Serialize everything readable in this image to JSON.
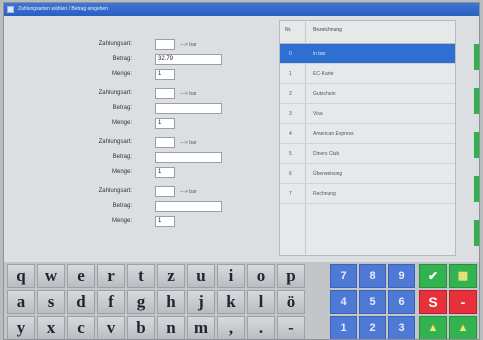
{
  "window": {
    "title": "Zahlungsarten wählen / Betrag eingeben"
  },
  "payments": [
    {
      "zahlungsart_label": "Zahlungsart:",
      "zahlungsart_value": "",
      "selected": "---> bar",
      "betrag_label": "Betrag:",
      "betrag_value": "32.79",
      "menge_label": "Menge:",
      "menge_value": "1"
    },
    {
      "zahlungsart_label": "Zahlungsart:",
      "zahlungsart_value": "",
      "selected": "---> bar",
      "betrag_label": "Betrag:",
      "betrag_value": "",
      "menge_label": "Menge:",
      "menge_value": "1"
    },
    {
      "zahlungsart_label": "Zahlungsart:",
      "zahlungsart_value": "",
      "selected": "---> bar",
      "betrag_label": "Betrag:",
      "betrag_value": "",
      "menge_label": "Menge:",
      "menge_value": "1"
    },
    {
      "zahlungsart_label": "Zahlungsart:",
      "zahlungsart_value": "",
      "selected": "---> bar",
      "betrag_label": "Betrag:",
      "betrag_value": "",
      "menge_label": "Menge:",
      "menge_value": "1"
    }
  ],
  "list": {
    "headers": [
      "Nr.",
      "Bezeichnung"
    ],
    "rows": [
      {
        "nr": "0",
        "name": "in bar",
        "selected": true
      },
      {
        "nr": "1",
        "name": "EC-Karte",
        "selected": false
      },
      {
        "nr": "2",
        "name": "Gutschein",
        "selected": false
      },
      {
        "nr": "3",
        "name": "Visa",
        "selected": false
      },
      {
        "nr": "4",
        "name": "American Express",
        "selected": false
      },
      {
        "nr": "5",
        "name": "Diners Club",
        "selected": false
      },
      {
        "nr": "6",
        "name": "Überweisung",
        "selected": false
      },
      {
        "nr": "7",
        "name": "Rechnung",
        "selected": false
      }
    ]
  },
  "keyboard": {
    "row1": [
      "q",
      "w",
      "e",
      "r",
      "t",
      "z",
      "u",
      "i",
      "o",
      "p"
    ],
    "row2": [
      "a",
      "s",
      "d",
      "f",
      "g",
      "h",
      "j",
      "k",
      "l",
      "ö"
    ],
    "row3": [
      "y",
      "x",
      "c",
      "v",
      "b",
      "n",
      "m",
      ",",
      ".",
      "-"
    ],
    "num_row1": [
      "7",
      "8",
      "9"
    ],
    "num_row2": [
      "4",
      "5",
      "6"
    ],
    "num_row3": [
      "1",
      "2",
      "3"
    ],
    "fn": {
      "ok": "✔",
      "grid": "▦",
      "s": "S",
      "minus": "-",
      "up": "▲"
    },
    "colors": {
      "num": "#4e79d4",
      "green": "#33b34f",
      "red": "#e6313a"
    }
  }
}
